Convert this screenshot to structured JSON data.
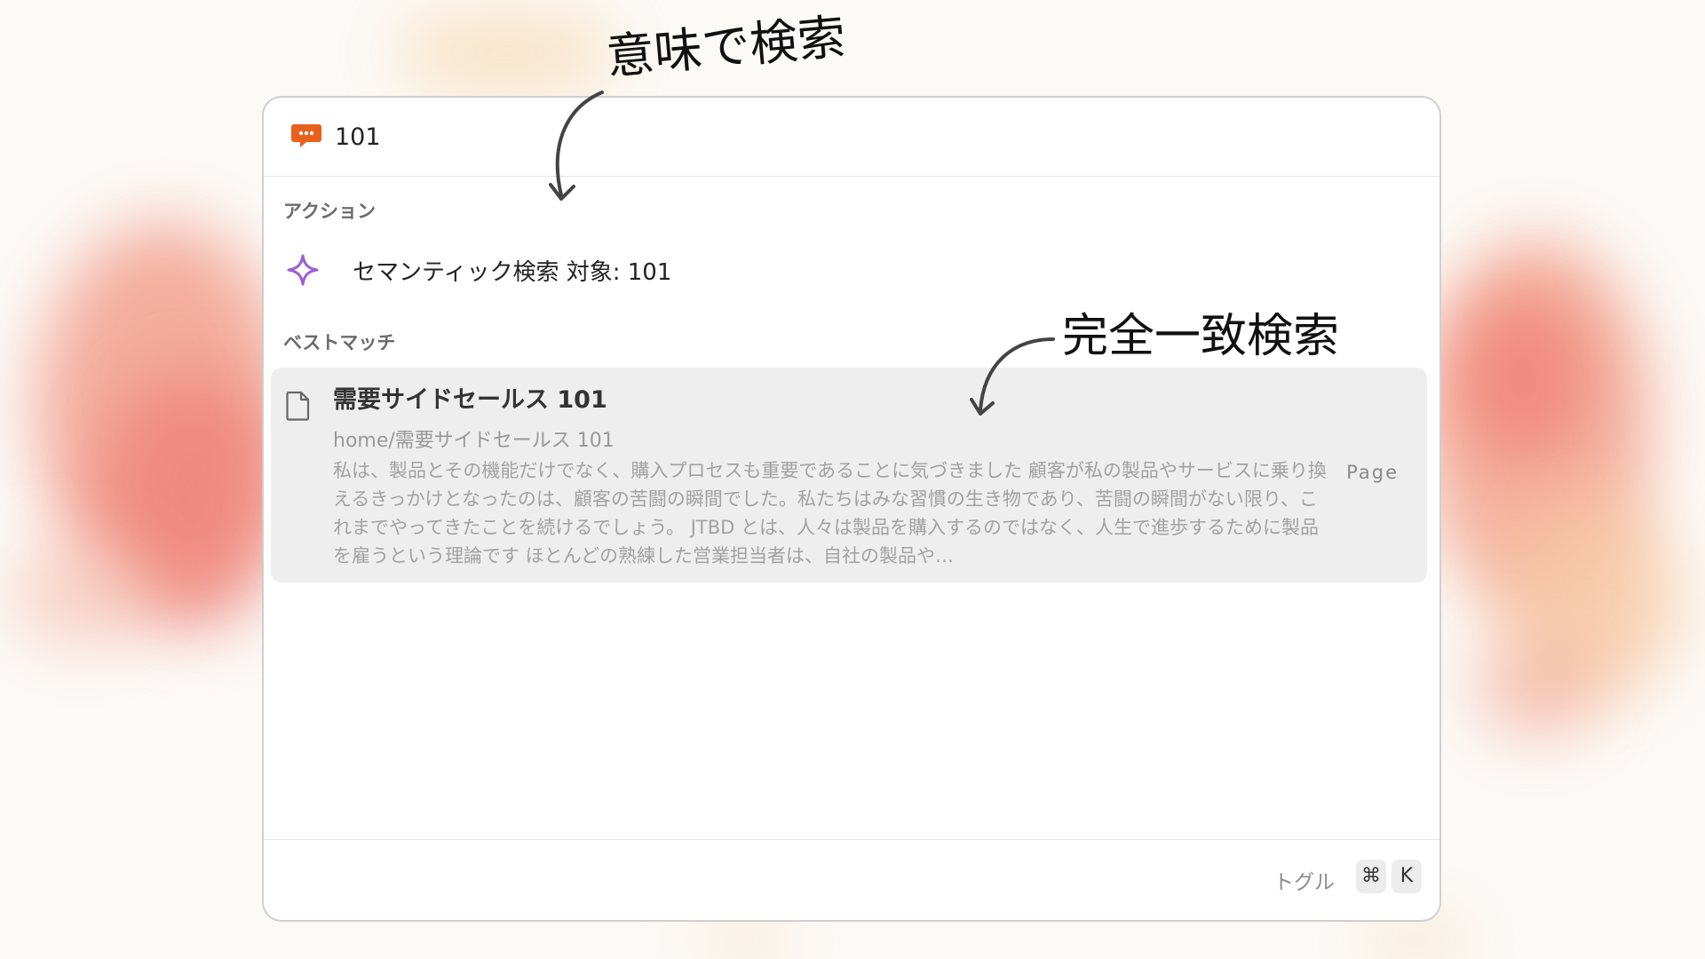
{
  "search": {
    "query": "101",
    "app_icon": "chat-bubble-icon",
    "app_icon_color": "#e8601c"
  },
  "sections": {
    "actions_label": "アクション",
    "best_match_label": "ベストマッチ"
  },
  "action": {
    "icon": "sparkle-icon",
    "icon_color": "#9b5fd6",
    "label": "セマンティック検索 対象: 101"
  },
  "result": {
    "icon": "document-icon",
    "title": "需要サイドセールス 101",
    "path": "home/需要サイドセールス 101",
    "snippet": "私は、製品とその機能だけでなく、購入プロセスも重要であることに気づきました 顧客が私の製品やサービスに乗り換えるきっかけとなったのは、顧客の苦闘の瞬間でした。私たちはみな習慣の生き物であり、苦闘の瞬間がない限り、これまでやってきたことを続けるでしょう。 JTBD とは、人々は製品を購入するのではなく、人生で進歩するために製品を雇うという理論です ほとんどの熟練した営業担当者は、自社の製品や…",
    "type": "Page"
  },
  "footer": {
    "toggle_label": "トグル",
    "keys": [
      "⌘",
      "K"
    ]
  },
  "annotations": {
    "semantic": "意味で検索",
    "exact": "完全一致検索"
  }
}
